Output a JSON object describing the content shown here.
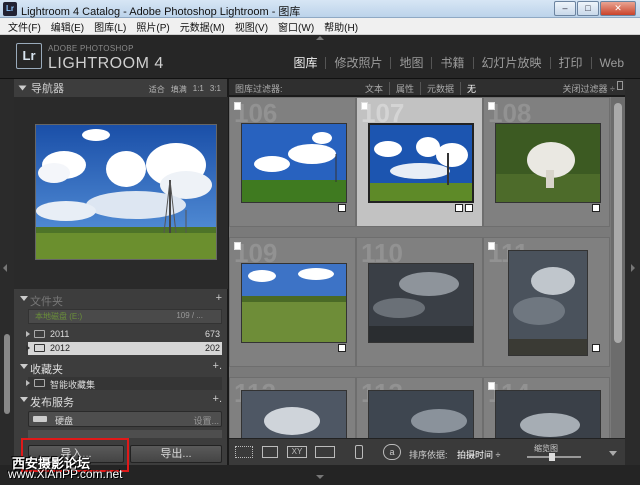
{
  "window": {
    "title": "Lightroom 4 Catalog - Adobe Photoshop Lightroom - 图库",
    "app_icon": "Lr"
  },
  "menu": [
    "文件(F)",
    "编辑(E)",
    "图库(L)",
    "照片(P)",
    "元数据(M)",
    "视图(V)",
    "窗口(W)",
    "帮助(H)"
  ],
  "brand": {
    "logo": "Lr",
    "sub": "ADOBE PHOTOSHOP",
    "main": "LIGHTROOM 4"
  },
  "modules": [
    "图库",
    "修改照片",
    "地图",
    "书籍",
    "幻灯片放映",
    "打印",
    "Web"
  ],
  "navigator": {
    "title": "导航器",
    "options": [
      "适合",
      "填满",
      "1:1",
      "3:1"
    ]
  },
  "folders": {
    "title": "文件夹",
    "volume": "本地磁盘 (E:)",
    "volume_count": "109 / ...",
    "items": [
      {
        "name": "2011",
        "count": "673"
      },
      {
        "name": "2012",
        "count": "202"
      }
    ]
  },
  "collections": {
    "title": "收藏夹",
    "items": [
      "智能收藏集"
    ]
  },
  "publish": {
    "title": "发布服务",
    "hard_drive": "硬盘",
    "setup": "设置..."
  },
  "buttons": {
    "import": "导入...",
    "export": "导出..."
  },
  "filter": {
    "label": "图库过滤器:",
    "tabs": [
      "文本",
      "属性",
      "元数据",
      "无"
    ],
    "active": "无",
    "close": "关闭过滤器 ÷"
  },
  "grid": {
    "numbers": [
      "106",
      "107",
      "108",
      "109",
      "110",
      "111",
      "112",
      "113",
      "114"
    ],
    "selected_index": 1
  },
  "toolbar": {
    "sort_label": "排序依据:",
    "sort_value": "拍摄时间 ÷",
    "thumb_label": "缩览图",
    "thumb_size": 0.45
  },
  "watermark": {
    "line1": "西安摄影论坛",
    "line2": "www.XiAnPP.com.net"
  },
  "colors": {
    "accent": "#e01919"
  }
}
